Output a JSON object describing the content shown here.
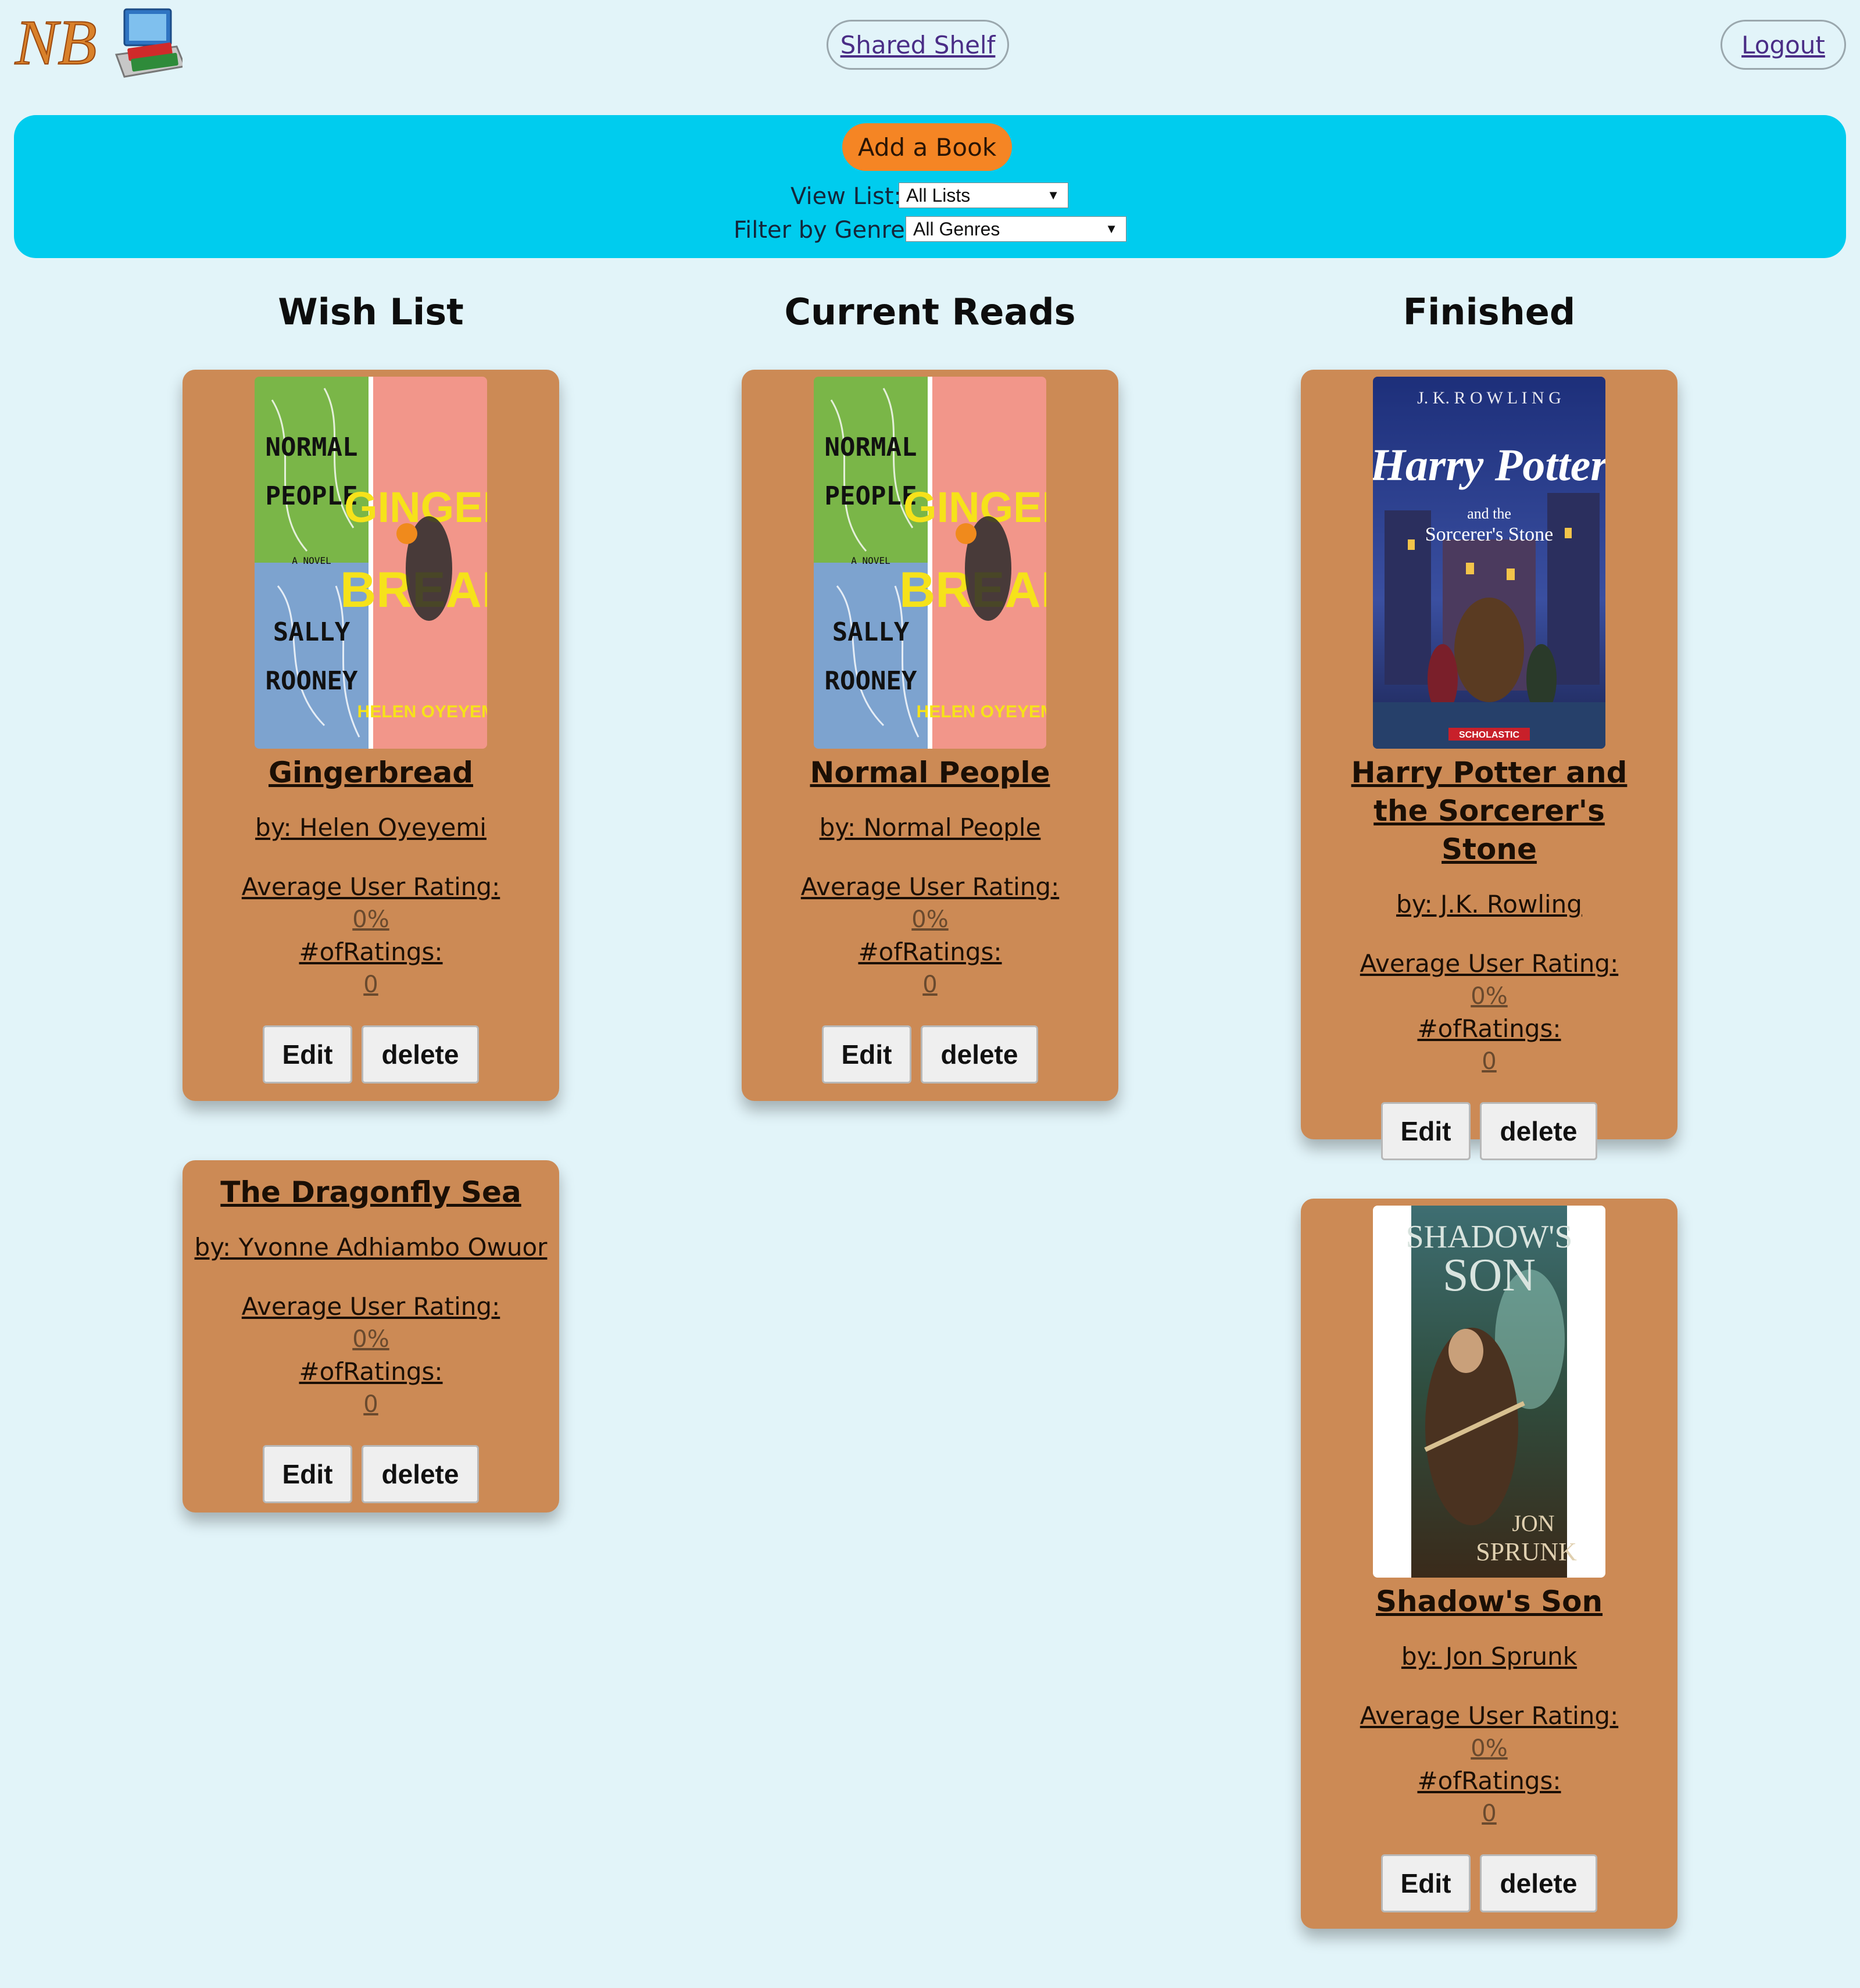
{
  "header": {
    "shared_shelf": "Shared Shelf",
    "logout": "Logout"
  },
  "controls": {
    "add_book": "Add a Book",
    "view_list_label": "View List:",
    "view_list_value": "All Lists",
    "genre_label": "Filter by Genre:",
    "genre_value": "All Genres"
  },
  "columns": {
    "wish": "Wish List",
    "current": "Current Reads",
    "finished": "Finished"
  },
  "card_labels": {
    "rating": "Average User Rating:",
    "count": "#ofRatings:",
    "edit": "Edit",
    "delete": "delete"
  },
  "cards": [
    {
      "title": "Gingerbread",
      "author": "by: Helen Oyeyemi",
      "rating": "0%",
      "count": "0"
    },
    {
      "title": "The Dragonfly Sea",
      "author": "by: Yvonne Adhiambo Owuor",
      "rating": "0%",
      "count": "0"
    },
    {
      "title": "Normal People",
      "author": "by: Normal People",
      "rating": "0%",
      "count": "0"
    },
    {
      "title": "Harry Potter and the Sorcerer's Stone",
      "author": "by: J.K. Rowling",
      "rating": "0%",
      "count": "0"
    },
    {
      "title": "Shadow's Son",
      "author": "by: Jon Sprunk",
      "rating": "0%",
      "count": "0"
    }
  ],
  "covers": {
    "normal_people": [
      "NORMAL",
      "PEOPLE",
      "A NOVEL",
      "SALLY",
      "ROONEY"
    ],
    "gingerbread": [
      "GINGER",
      "BREAD",
      "HELEN OYEYEMI"
    ],
    "harry_potter": [
      "J. K. R O W L I N G",
      "Harry Potter",
      "and the",
      "Sorcerer's Stone",
      "SCHOLASTIC"
    ],
    "shadows_son": [
      "SHADOW'S",
      "SON",
      "JON",
      "SPRUNK"
    ]
  },
  "logo_text": "NB",
  "colors": {
    "page_bg": "#e2f4f9",
    "control_bar": "#00ccee",
    "add_button": "#f58524",
    "card": "#cc8a55"
  }
}
